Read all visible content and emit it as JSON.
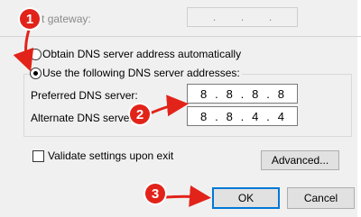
{
  "gateway": {
    "label": "efault gateway:",
    "octets": [
      ".",
      ".",
      "."
    ]
  },
  "dns": {
    "auto_label": "Obtain DNS server address automatically",
    "manual_label": "Use the following DNS server addresses:",
    "preferred_label": "Preferred DNS server:",
    "preferred_octets": [
      "8",
      ".",
      "8",
      ".",
      "8",
      ".",
      "8"
    ],
    "alternate_label": "Alternate DNS server:",
    "alternate_octets": [
      "8",
      ".",
      "8",
      ".",
      "4",
      ".",
      "4"
    ]
  },
  "validate_label": "Validate settings upon exit",
  "buttons": {
    "advanced": "Advanced...",
    "ok": "OK",
    "cancel": "Cancel"
  },
  "annotations": {
    "step1": "1",
    "step2": "2",
    "step3": "3",
    "color": "#e2231a"
  }
}
